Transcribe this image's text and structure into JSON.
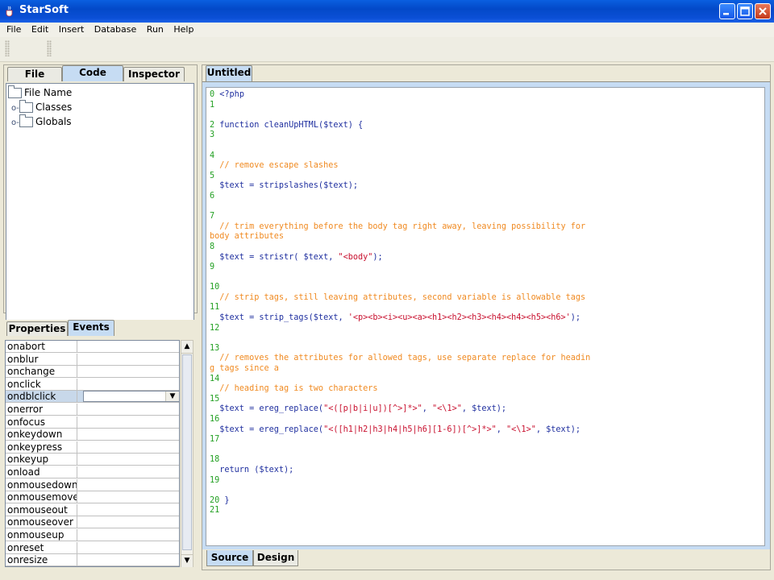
{
  "window": {
    "title": "StarSoft"
  },
  "menubar": {
    "items": [
      "File",
      "Edit",
      "Insert",
      "Database",
      "Run",
      "Help"
    ]
  },
  "left_panel": {
    "tabs": [
      "File",
      "Code",
      "Inspector"
    ],
    "active_tab": "Code",
    "tree": {
      "root": "File Name",
      "children": [
        "Classes",
        "Globals"
      ]
    }
  },
  "lower_panel": {
    "tabs": [
      "Properties",
      "Events"
    ],
    "active_tab": "Events",
    "events": [
      "onabort",
      "onblur",
      "onchange",
      "onclick",
      "ondblclick",
      "onerror",
      "onfocus",
      "onkeydown",
      "onkeypress",
      "onkeyup",
      "onload",
      "onmousedown",
      "onmousemove",
      "onmouseout",
      "onmouseover",
      "onmouseup",
      "onreset",
      "onresize"
    ],
    "selected_event": "ondblclick"
  },
  "editor": {
    "document_tab": "Untitled",
    "bottom_tabs": [
      "Source",
      "Design"
    ],
    "active_bottom_tab": "Source",
    "lines": [
      {
        "n": "0",
        "segs": [
          [
            "kw",
            "<?php"
          ]
        ]
      },
      {
        "n": "1",
        "segs": []
      },
      {
        "n": "",
        "segs": []
      },
      {
        "n": "2",
        "segs": [
          [
            "kw",
            "function cleanUpHTML($text) {"
          ]
        ]
      },
      {
        "n": "3",
        "segs": []
      },
      {
        "n": "",
        "segs": []
      },
      {
        "n": "4",
        "segs": []
      },
      {
        "n": "",
        "segs": [
          [
            "cm",
            "  // remove escape slashes"
          ]
        ]
      },
      {
        "n": "5",
        "segs": []
      },
      {
        "n": "",
        "segs": [
          [
            "kw",
            "  $text = stripslashes($text);"
          ]
        ]
      },
      {
        "n": "6",
        "segs": []
      },
      {
        "n": "",
        "segs": []
      },
      {
        "n": "7",
        "segs": []
      },
      {
        "n": "",
        "segs": [
          [
            "cm",
            "  // trim everything before the body tag right away, leaving possibility for"
          ]
        ]
      },
      {
        "n": "",
        "segs": [
          [
            "cm",
            "body attributes"
          ]
        ]
      },
      {
        "n": "8",
        "segs": []
      },
      {
        "n": "",
        "segs": [
          [
            "kw",
            "  $text = stristr( $text, "
          ],
          [
            "st",
            "\"<body\""
          ],
          [
            "kw",
            ");"
          ]
        ]
      },
      {
        "n": "9",
        "segs": []
      },
      {
        "n": "",
        "segs": []
      },
      {
        "n": "10",
        "segs": []
      },
      {
        "n": "",
        "segs": [
          [
            "cm",
            "  // strip tags, still leaving attributes, second variable is allowable tags"
          ]
        ]
      },
      {
        "n": "11",
        "segs": []
      },
      {
        "n": "",
        "segs": [
          [
            "kw",
            "  $text = strip_tags($text, "
          ],
          [
            "st",
            "'<p><b><i><u><a><h1><h2><h3><h4><h4><h5><h6>'"
          ],
          [
            "kw",
            ");"
          ]
        ]
      },
      {
        "n": "12",
        "segs": []
      },
      {
        "n": "",
        "segs": []
      },
      {
        "n": "13",
        "segs": []
      },
      {
        "n": "",
        "segs": [
          [
            "cm",
            "  // removes the attributes for allowed tags, use separate replace for headin"
          ]
        ]
      },
      {
        "n": "",
        "segs": [
          [
            "cm",
            "g tags since a"
          ]
        ]
      },
      {
        "n": "14",
        "segs": []
      },
      {
        "n": "",
        "segs": [
          [
            "cm",
            "  // heading tag is two characters"
          ]
        ]
      },
      {
        "n": "15",
        "segs": []
      },
      {
        "n": "",
        "segs": [
          [
            "kw",
            "  $text = ereg_replace("
          ],
          [
            "st",
            "\"<([p|b|i|u])[^>]*>\""
          ],
          [
            "kw",
            ", "
          ],
          [
            "st",
            "\"<\\1>\""
          ],
          [
            "kw",
            ", $text);"
          ]
        ]
      },
      {
        "n": "16",
        "segs": []
      },
      {
        "n": "",
        "segs": [
          [
            "kw",
            "  $text = ereg_replace("
          ],
          [
            "st",
            "\"<([h1|h2|h3|h4|h5|h6][1-6])[^>]*>\""
          ],
          [
            "kw",
            ", "
          ],
          [
            "st",
            "\"<\\1>\""
          ],
          [
            "kw",
            ", $text);"
          ]
        ]
      },
      {
        "n": "17",
        "segs": []
      },
      {
        "n": "",
        "segs": []
      },
      {
        "n": "18",
        "segs": []
      },
      {
        "n": "",
        "segs": [
          [
            "kw",
            "  return ($text);"
          ]
        ]
      },
      {
        "n": "19",
        "segs": []
      },
      {
        "n": "",
        "segs": []
      },
      {
        "n": "20",
        "segs": [
          [
            "kw",
            "}"
          ]
        ]
      },
      {
        "n": "21",
        "segs": []
      }
    ]
  }
}
